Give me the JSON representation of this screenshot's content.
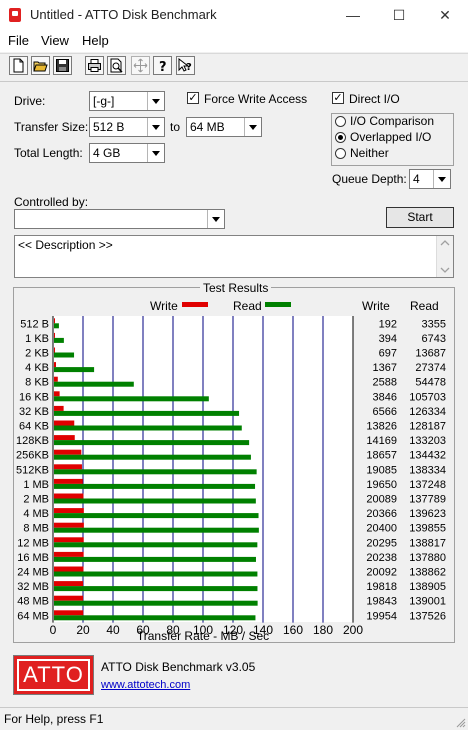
{
  "window": {
    "title": "Untitled - ATTO Disk Benchmark",
    "minimize_glyph": "—",
    "maximize_glyph": "☐",
    "close_glyph": "✕"
  },
  "menu": [
    "File",
    "View",
    "Help"
  ],
  "toolbar": [
    "new-icon",
    "open-icon",
    "save-icon",
    "print-icon",
    "print-preview-icon",
    "move-icon",
    "help-icon",
    "context-help-icon"
  ],
  "drive": {
    "label": "Drive:",
    "value": "[-g-]"
  },
  "transfer_size": {
    "label": "Transfer Size:",
    "from": "512 B",
    "to_label": "to",
    "to": "64 MB"
  },
  "total_length": {
    "label": "Total Length:",
    "value": "4 GB"
  },
  "force_write": {
    "label": "Force Write Access",
    "checked": true
  },
  "direct_io": {
    "label": "Direct I/O",
    "checked": true
  },
  "io_mode": {
    "options": [
      "I/O Comparison",
      "Overlapped I/O",
      "Neither"
    ],
    "selected": 1
  },
  "queue_depth": {
    "label": "Queue Depth:",
    "value": "4"
  },
  "controlled_by": {
    "label": "Controlled by:",
    "value": ""
  },
  "start_label": "Start",
  "description": "<< Description >>",
  "results": {
    "title": "Test Results",
    "write_label": "Write",
    "read_label": "Read",
    "col_write": "Write",
    "col_read": "Read"
  },
  "colors": {
    "write": "#e00000",
    "read": "#008000",
    "grid": "#000080",
    "accent": "#e02020"
  },
  "chart_data": {
    "type": "bar",
    "orientation": "horizontal",
    "categories": [
      "512 B",
      "1 KB",
      "2 KB",
      "4 KB",
      "8 KB",
      "16 KB",
      "32 KB",
      "64 KB",
      "128KB",
      "256KB",
      "512KB",
      "1 MB",
      "2 MB",
      "4 MB",
      "8 MB",
      "12 MB",
      "16 MB",
      "24 MB",
      "32 MB",
      "48 MB",
      "64 MB"
    ],
    "series": [
      {
        "name": "Write",
        "values": [
          192,
          394,
          697,
          1367,
          2588,
          3846,
          6566,
          13826,
          14169,
          18657,
          19085,
          19650,
          20089,
          20366,
          20400,
          20295,
          20238,
          20092,
          19818,
          19843,
          19954
        ]
      },
      {
        "name": "Read",
        "values": [
          3355,
          6743,
          13687,
          27374,
          54478,
          105703,
          126334,
          128187,
          133203,
          134432,
          138334,
          137248,
          137789,
          139623,
          139855,
          138817,
          137880,
          138862,
          138905,
          139001,
          137526
        ]
      }
    ],
    "xlabel": "Transfer Rate - MB / Sec",
    "xticks": [
      "0",
      "20",
      "40",
      "60",
      "80",
      "100",
      "120",
      "140",
      "160",
      "180",
      "200"
    ],
    "xlim": [
      0,
      200
    ]
  },
  "about": {
    "version": "ATTO Disk Benchmark v3.05",
    "url": "www.attotech.com",
    "logo_text": "ATTO"
  },
  "status": "For Help, press F1"
}
